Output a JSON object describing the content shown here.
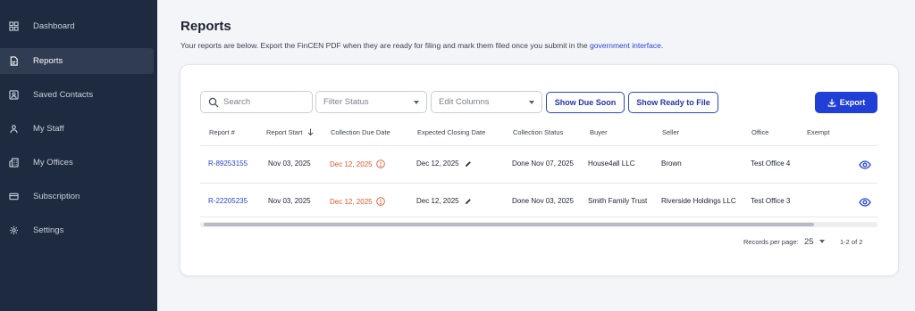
{
  "sidebar": {
    "items": [
      {
        "label": "Dashboard",
        "icon": "dashboard-icon"
      },
      {
        "label": "Reports",
        "icon": "document-icon",
        "active": true
      },
      {
        "label": "Saved Contacts",
        "icon": "contacts-icon"
      },
      {
        "label": "My Staff",
        "icon": "staff-icon"
      },
      {
        "label": "My Offices",
        "icon": "offices-icon"
      },
      {
        "label": "Subscription",
        "icon": "card-icon"
      },
      {
        "label": "Settings",
        "icon": "gear-icon"
      }
    ]
  },
  "header": {
    "title": "Reports",
    "description": "Your reports are below. Export the FinCEN PDF when they are ready for filing and mark them filed once you submit in the",
    "link_text": "government interface",
    "period": "."
  },
  "toolbar": {
    "search_placeholder": "Search",
    "filter_label": "Filter Status",
    "columns_label": "Edit Columns",
    "due_soon_label": "Show Due Soon",
    "ready_label": "Show Ready to File",
    "export_label": "Export"
  },
  "table": {
    "columns": [
      "Report #",
      "Report Start",
      "Collection Due Date",
      "Expected Closing Date",
      "Collection Status",
      "Buyer",
      "Seller",
      "Office",
      "Exempt"
    ],
    "sort_icon": "arrow-down-icon",
    "rows": [
      {
        "report": "R-89253155",
        "start": "Nov 03, 2025",
        "due": "Dec 12, 2025",
        "closing": "Dec 12, 2025",
        "status": "Done Nov 07, 2025",
        "buyer": "House4all LLC",
        "seller": "Brown",
        "office": "Test Office 4",
        "exempt": ""
      },
      {
        "report": "R-22205235",
        "start": "Nov 03, 2025",
        "due": "Dec 12, 2025",
        "closing": "Dec 12, 2025",
        "status": "Done Nov 03, 2025",
        "buyer": "Smith Family Trust",
        "seller": "Riverside Holdings LLC",
        "office": "Test Office 3",
        "exempt": ""
      }
    ]
  },
  "footer": {
    "records_label": "Records per page:",
    "per_page": "25",
    "range": "1-2 of 2"
  },
  "colors": {
    "sidebar": "#1d2a3f",
    "accent": "#1f3fd6",
    "overdue": "#e2542a",
    "link": "#2646d6"
  }
}
